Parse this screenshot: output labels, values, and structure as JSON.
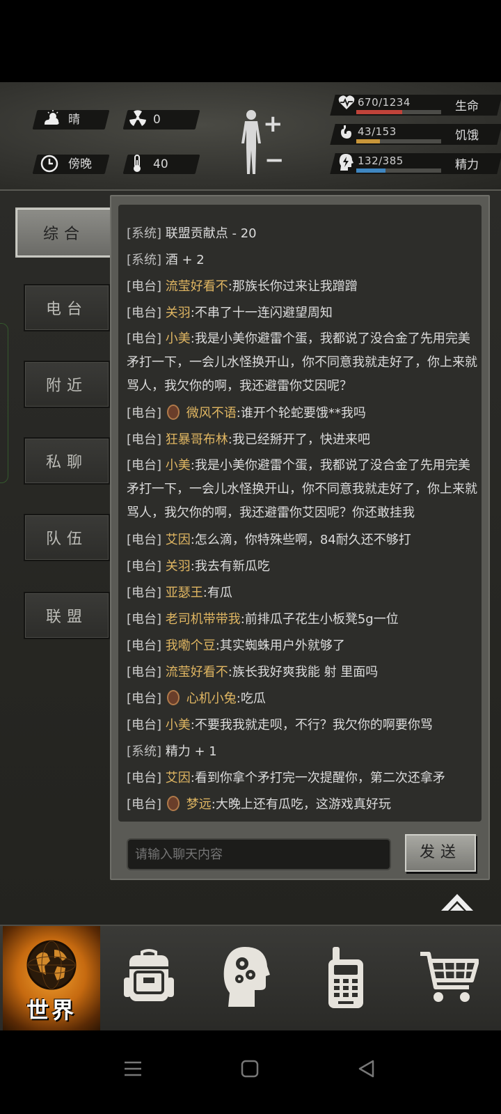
{
  "status": {
    "weather": "晴",
    "radiation": "0",
    "time_of_day": "傍晚",
    "temperature": "40"
  },
  "vitals": [
    {
      "label": "生命",
      "value": "670/1234",
      "fraction": 0.543,
      "color": "#c0433a",
      "icon": "heartbeat-icon"
    },
    {
      "label": "饥饿",
      "value": "43/153",
      "fraction": 0.281,
      "color": "#c8963a",
      "icon": "stomach-icon"
    },
    {
      "label": "精力",
      "value": "132/385",
      "fraction": 0.343,
      "color": "#3f86c0",
      "icon": "energy-head-icon"
    }
  ],
  "tabs": [
    {
      "label": "综合",
      "active": true
    },
    {
      "label": "电台",
      "active": false
    },
    {
      "label": "附近",
      "active": false
    },
    {
      "label": "私聊",
      "active": false
    },
    {
      "label": "队伍",
      "active": false
    },
    {
      "label": "联盟",
      "active": false
    }
  ],
  "messages": [
    {
      "channel": "[系统]",
      "name": "",
      "text": "联盟贡献点 - 20"
    },
    {
      "channel": "[系统]",
      "name": "",
      "text": "酒 + 2"
    },
    {
      "channel": "[电台]",
      "name": "流莹好看不",
      "text": ":那族长你过来让我蹭蹭"
    },
    {
      "channel": "[电台]",
      "name": "关羽",
      "text": ":不串了十一连闪避望周知"
    },
    {
      "channel": "[电台]",
      "name": "小美",
      "text": ":我是小美你避雷个蛋，我都说了没合金了先用完美矛打一下，一会儿水怪换开山，你不同意我就走好了，你上来就骂人，我欠你的啊，我还避雷你艾因呢？"
    },
    {
      "channel": "[电台]",
      "name": "微风不语",
      "text": ":谁开个轮蛇要饿**我吗",
      "avatar": true
    },
    {
      "channel": "[电台]",
      "name": "狂暴哥布林",
      "text": ":我已经掰开了，快进来吧"
    },
    {
      "channel": "[电台]",
      "name": "小美",
      "text": ":我是小美你避雷个蛋，我都说了没合金了先用完美矛打一下，一会儿水怪换开山，你不同意我就走好了，你上来就骂人，我欠你的啊，我还避雷你艾因呢？你还敢挂我"
    },
    {
      "channel": "[电台]",
      "name": "艾因",
      "text": ":怎么滴，你特殊些啊，84耐久还不够打"
    },
    {
      "channel": "[电台]",
      "name": "关羽",
      "text": ":我去有新瓜吃"
    },
    {
      "channel": "[电台]",
      "name": "亚瑟王",
      "text": ":有瓜"
    },
    {
      "channel": "[电台]",
      "name": "老司机带带我",
      "text": ":前排瓜子花生小板凳5g一位"
    },
    {
      "channel": "[电台]",
      "name": "我嘞个豆",
      "text": ":其实蜘蛛用户外就够了"
    },
    {
      "channel": "[电台]",
      "name": "流莹好看不",
      "text": ":族长我好爽我能 射 里面吗"
    },
    {
      "channel": "[电台]",
      "name": "心机小兔",
      "text": ":吃瓜",
      "avatar": true
    },
    {
      "channel": "[电台]",
      "name": "小美",
      "text": ":不要我我就走呗，不行？我欠你的啊要你骂"
    },
    {
      "channel": "[系统]",
      "name": "",
      "text": "精力 + 1"
    },
    {
      "channel": "[电台]",
      "name": "艾因",
      "text": ":看到你拿个矛打完一次提醒你，第二次还拿矛"
    },
    {
      "channel": "[电台]",
      "name": "梦远",
      "text": ":大晚上还有瓜吃，这游戏真好玩",
      "avatar": true
    }
  ],
  "input": {
    "placeholder": "请输入聊天内容",
    "value": ""
  },
  "send_label": "发送",
  "nav": {
    "world_label": "世界",
    "items": [
      "world-globe-icon",
      "backpack-icon",
      "skills-head-icon",
      "radio-icon",
      "shop-cart-icon"
    ]
  },
  "colors": {
    "name": "#e0b662",
    "accent_orange": "#f0a030"
  }
}
